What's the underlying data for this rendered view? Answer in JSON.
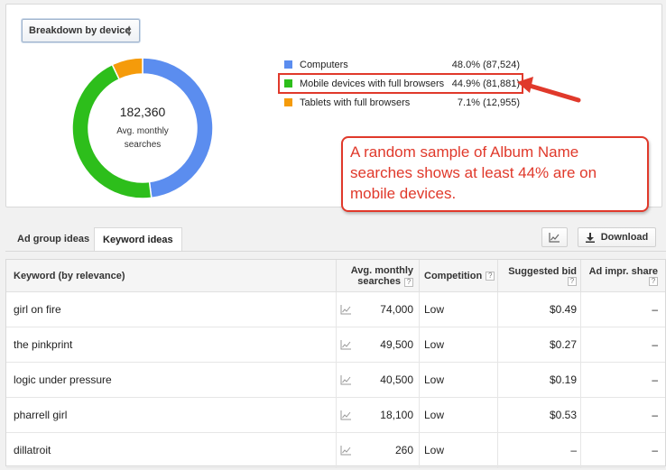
{
  "breakdown": {
    "label": "Breakdown by device",
    "selector_icon": "updown-arrows-icon"
  },
  "donut": {
    "total": "182,360",
    "caption": "Avg. monthly searches"
  },
  "chart_data": {
    "type": "pie",
    "categories": [
      "Computers",
      "Mobile devices with full browsers",
      "Tablets with full browsers"
    ],
    "values": [
      48.0,
      44.9,
      7.1
    ],
    "colors": [
      "#5b8def",
      "#2dbe1b",
      "#f59b0a"
    ]
  },
  "legend": [
    {
      "label": "Computers",
      "value": "48.0% (87,524)",
      "color": "#5b8def"
    },
    {
      "label": "Mobile devices with full browsers",
      "value": "44.9% (81,881)",
      "color": "#2dbe1b"
    },
    {
      "label": "Tablets with full browsers",
      "value": "7.1% (12,955)",
      "color": "#f59b0a"
    }
  ],
  "callout": {
    "text": "A random sample of Album Name searches shows at least 44% are on mobile devices.",
    "color": "#e0392b"
  },
  "tabs": [
    {
      "label": "Ad group ideas",
      "active": false
    },
    {
      "label": "Keyword ideas",
      "active": true
    }
  ],
  "toolbar": {
    "chart_icon": "line-chart-icon",
    "download_label": "Download",
    "download_icon": "download-icon"
  },
  "table": {
    "headers": {
      "keyword": "Keyword (by relevance)",
      "avg_line1": "Avg. monthly",
      "avg_line2": "searches",
      "competition": "Competition",
      "bid": "Suggested bid",
      "share": "Ad impr. share",
      "help": "?"
    },
    "rows": [
      {
        "keyword": "girl on fire",
        "avg": "74,000",
        "competition": "Low",
        "bid": "$0.49",
        "share": "–"
      },
      {
        "keyword": "the pinkprint",
        "avg": "49,500",
        "competition": "Low",
        "bid": "$0.27",
        "share": "–"
      },
      {
        "keyword": "logic under pressure",
        "avg": "40,500",
        "competition": "Low",
        "bid": "$0.19",
        "share": "–"
      },
      {
        "keyword": "pharrell girl",
        "avg": "18,100",
        "competition": "Low",
        "bid": "$0.53",
        "share": "–"
      },
      {
        "keyword": "dillatroit",
        "avg": "260",
        "competition": "Low",
        "bid": "–",
        "share": "–"
      }
    ]
  }
}
